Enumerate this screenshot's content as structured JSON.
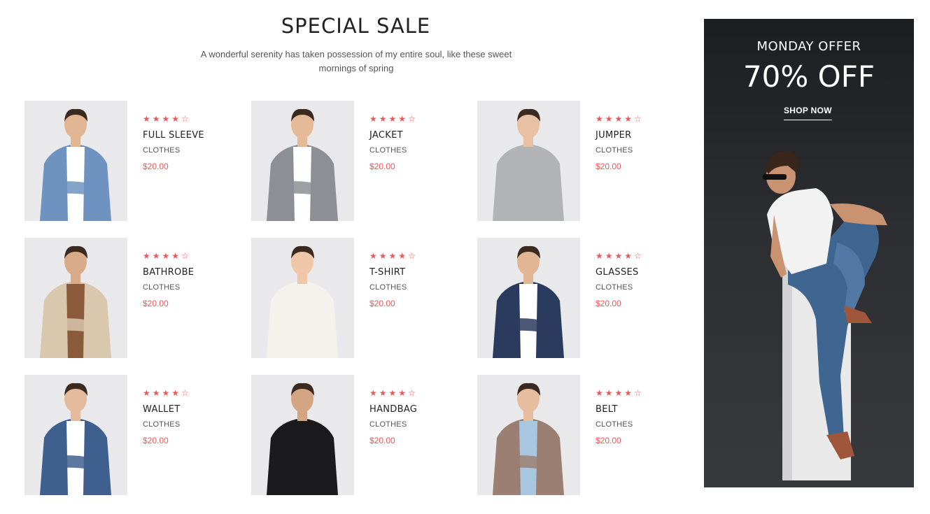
{
  "section": {
    "title": "SPECIAL SALE",
    "subtitle": "A wonderful serenity has taken possession of my entire soul, like these sweet mornings of spring"
  },
  "colors": {
    "accent": "#e9585a",
    "text": "#222222",
    "muted": "#555555",
    "banner_bg": "#2a2b2e"
  },
  "products": [
    {
      "name": "FULL SLEEVE",
      "category": "CLOTHES",
      "price": "$20.00",
      "rating": 4,
      "rating_max": 5,
      "shirt": "#6f93c0",
      "inner": "#ffffff",
      "skin": "#e2b595"
    },
    {
      "name": "JACKET",
      "category": "CLOTHES",
      "price": "$20.00",
      "rating": 4,
      "rating_max": 5,
      "shirt": "#8d8f97",
      "inner": "#ffffff",
      "skin": "#e4b998"
    },
    {
      "name": "JUMPER",
      "category": "CLOTHES",
      "price": "$20.00",
      "rating": 4,
      "rating_max": 5,
      "shirt": "#b2b3b6",
      "inner": "#b2b3b6",
      "skin": "#e8c0a4"
    },
    {
      "name": "BATHROBE",
      "category": "CLOTHES",
      "price": "$20.00",
      "rating": 4,
      "rating_max": 5,
      "shirt": "#d9c7ae",
      "inner": "#8a5a3a",
      "skin": "#d9aa88"
    },
    {
      "name": "T-SHIRT",
      "category": "CLOTHES",
      "price": "$20.00",
      "rating": 4,
      "rating_max": 5,
      "shirt": "#f4f2ec",
      "inner": "#f4f2ec",
      "skin": "#efc6a8"
    },
    {
      "name": "GLASSES",
      "category": "CLOTHES",
      "price": "$20.00",
      "rating": 4,
      "rating_max": 5,
      "shirt": "#2b3b5e",
      "inner": "#ffffff",
      "skin": "#e2b595"
    },
    {
      "name": "WALLET",
      "category": "CLOTHES",
      "price": "$20.00",
      "rating": 4,
      "rating_max": 5,
      "shirt": "#3f5f8f",
      "inner": "#ffffff",
      "skin": "#e4bb9c"
    },
    {
      "name": "HANDBAG",
      "category": "CLOTHES",
      "price": "$20.00",
      "rating": 4,
      "rating_max": 5,
      "shirt": "#1b1b1d",
      "inner": "#1b1b1d",
      "skin": "#d4a583"
    },
    {
      "name": "BELT",
      "category": "CLOTHES",
      "price": "$20.00",
      "rating": 4,
      "rating_max": 5,
      "shirt": "#9a7f72",
      "inner": "#a9c6e0",
      "skin": "#e6bd9f"
    }
  ],
  "banner": {
    "kicker": "MONDAY OFFER",
    "headline": "70% OFF",
    "cta": "SHOP NOW"
  }
}
